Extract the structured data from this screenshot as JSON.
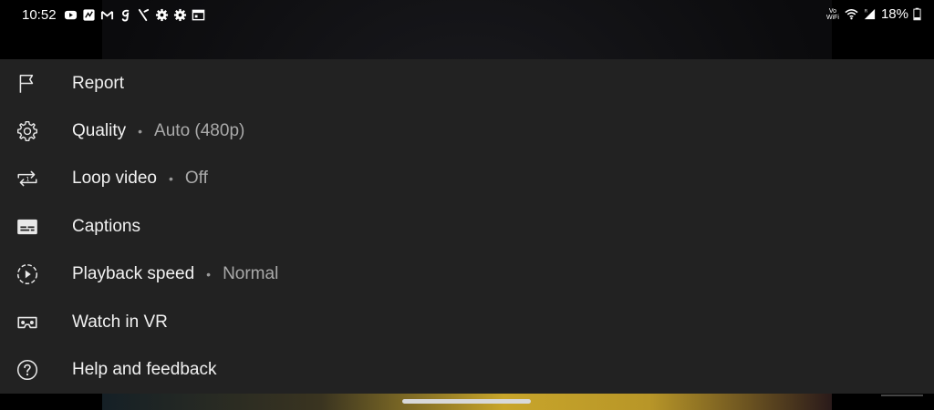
{
  "status_bar": {
    "time": "10:52",
    "notification_icons": [
      "youtube-icon",
      "app-icon",
      "gmail-icon",
      "g-icon",
      "slash-icon",
      "gear-icon",
      "gear-icon",
      "calendar-icon"
    ],
    "volte_line1": "Vo",
    "volte_line2": "WiFi",
    "battery_percent": "18%"
  },
  "menu": {
    "items": [
      {
        "label": "Report",
        "icon": "flag-icon"
      },
      {
        "label": "Quality",
        "value": "Auto (480p)",
        "icon": "gear-icon"
      },
      {
        "label": "Loop video",
        "value": "Off",
        "icon": "loop-icon"
      },
      {
        "label": "Captions",
        "icon": "captions-icon"
      },
      {
        "label": "Playback speed",
        "value": "Normal",
        "icon": "playback-speed-icon"
      },
      {
        "label": "Watch in VR",
        "icon": "vr-headset-icon"
      },
      {
        "label": "Help and feedback",
        "icon": "help-icon"
      }
    ],
    "separator": "•"
  },
  "colors": {
    "sheet_background": "#222222",
    "text_primary": "#f1f1f1",
    "text_secondary": "#aaaaaa"
  }
}
